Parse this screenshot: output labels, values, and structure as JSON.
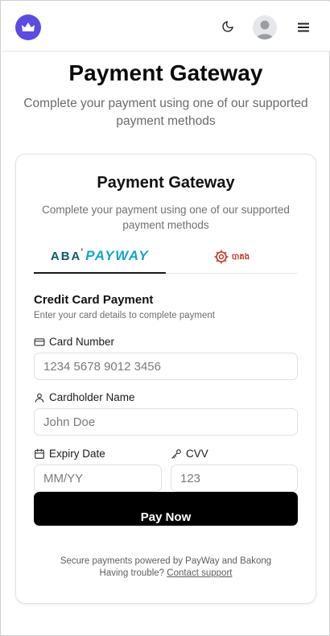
{
  "header": {
    "logo_icon": "crown-icon",
    "theme_icon": "moon-icon",
    "avatar_icon": "user-avatar-icon",
    "menu_icon": "hamburger-menu-icon",
    "brand_color": "#5b4be0"
  },
  "page": {
    "title": "Payment Gateway",
    "subtitle": "Complete your payment using one of our supported payment methods"
  },
  "card": {
    "title": "Payment Gateway",
    "subtitle": "Complete your payment using one of our supported payment methods",
    "tabs": [
      {
        "id": "payway",
        "brand_prefix": "ABA",
        "brand_mark": "'",
        "brand_name": "PAYWAY",
        "active": true
      },
      {
        "id": "bakong",
        "logo_text": "បាគង",
        "active": false
      }
    ],
    "section_title": "Credit Card Payment",
    "section_desc": "Enter your card details to complete payment",
    "fields": {
      "card_number": {
        "label": "Card Number",
        "placeholder": "1234 5678 9012 3456",
        "icon": "credit-card-icon"
      },
      "cardholder": {
        "label": "Cardholder Name",
        "placeholder": "John Doe",
        "icon": "user-icon"
      },
      "expiry": {
        "label": "Expiry Date",
        "placeholder": "MM/YY",
        "icon": "calendar-icon"
      },
      "cvv": {
        "label": "CVV",
        "placeholder": "123",
        "icon": "key-icon"
      }
    },
    "pay_button": "Pay Now",
    "footer": {
      "secure_text": "Secure payments powered by PayWay and Bakong",
      "trouble_text": "Having trouble?",
      "support_link": "Contact support"
    }
  }
}
